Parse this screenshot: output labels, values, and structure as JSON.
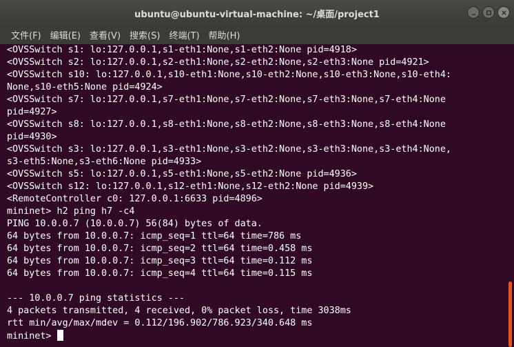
{
  "window": {
    "title": "ubuntu@ubuntu-virtual-machine: ~/桌面/project1"
  },
  "menubar": {
    "items": [
      {
        "label": "文件(F)"
      },
      {
        "label": "编辑(E)"
      },
      {
        "label": "查看(V)"
      },
      {
        "label": "搜索(S)"
      },
      {
        "label": "终端(T)"
      },
      {
        "label": "帮助(H)"
      }
    ]
  },
  "terminal": {
    "lines": [
      "<OVSSwitch s1: lo:127.0.0.1,s1-eth1:None,s1-eth2:None pid=4918>",
      "<OVSSwitch s2: lo:127.0.0.1,s2-eth1:None,s2-eth2:None,s2-eth3:None pid=4921>",
      "<OVSSwitch s10: lo:127.0.0.1,s10-eth1:None,s10-eth2:None,s10-eth3:None,s10-eth4:",
      "None,s10-eth5:None pid=4924>",
      "<OVSSwitch s7: lo:127.0.0.1,s7-eth1:None,s7-eth2:None,s7-eth3:None,s7-eth4:None",
      "pid=4927>",
      "<OVSSwitch s8: lo:127.0.0.1,s8-eth1:None,s8-eth2:None,s8-eth3:None,s8-eth4:None",
      "pid=4930>",
      "<OVSSwitch s3: lo:127.0.0.1,s3-eth1:None,s3-eth2:None,s3-eth3:None,s3-eth4:None,",
      "s3-eth5:None,s3-eth6:None pid=4933>",
      "<OVSSwitch s5: lo:127.0.0.1,s5-eth1:None,s5-eth2:None pid=4936>",
      "<OVSSwitch s12: lo:127.0.0.1,s12-eth1:None,s12-eth2:None pid=4939>",
      "<RemoteController c0: 127.0.0.1:6633 pid=4896>",
      "mininet> h2 ping h7 -c4",
      "PING 10.0.0.7 (10.0.0.7) 56(84) bytes of data.",
      "64 bytes from 10.0.0.7: icmp_seq=1 ttl=64 time=786 ms",
      "64 bytes from 10.0.0.7: icmp_seq=2 ttl=64 time=0.458 ms",
      "64 bytes from 10.0.0.7: icmp_seq=3 ttl=64 time=0.112 ms",
      "64 bytes from 10.0.0.7: icmp_seq=4 ttl=64 time=0.115 ms",
      "",
      "--- 10.0.0.7 ping statistics ---",
      "4 packets transmitted, 4 received, 0% packet loss, time 3038ms",
      "rtt min/avg/max/mdev = 0.112/196.902/786.923/340.648 ms"
    ],
    "prompt": "mininet> "
  },
  "colors": {
    "background": "#300a24",
    "titlebar": "#3c3b37",
    "text": "#ffffff",
    "accent": "#e95420"
  },
  "icons": {
    "minimize": "minimize-icon",
    "maximize": "maximize-icon",
    "close": "close-icon"
  }
}
